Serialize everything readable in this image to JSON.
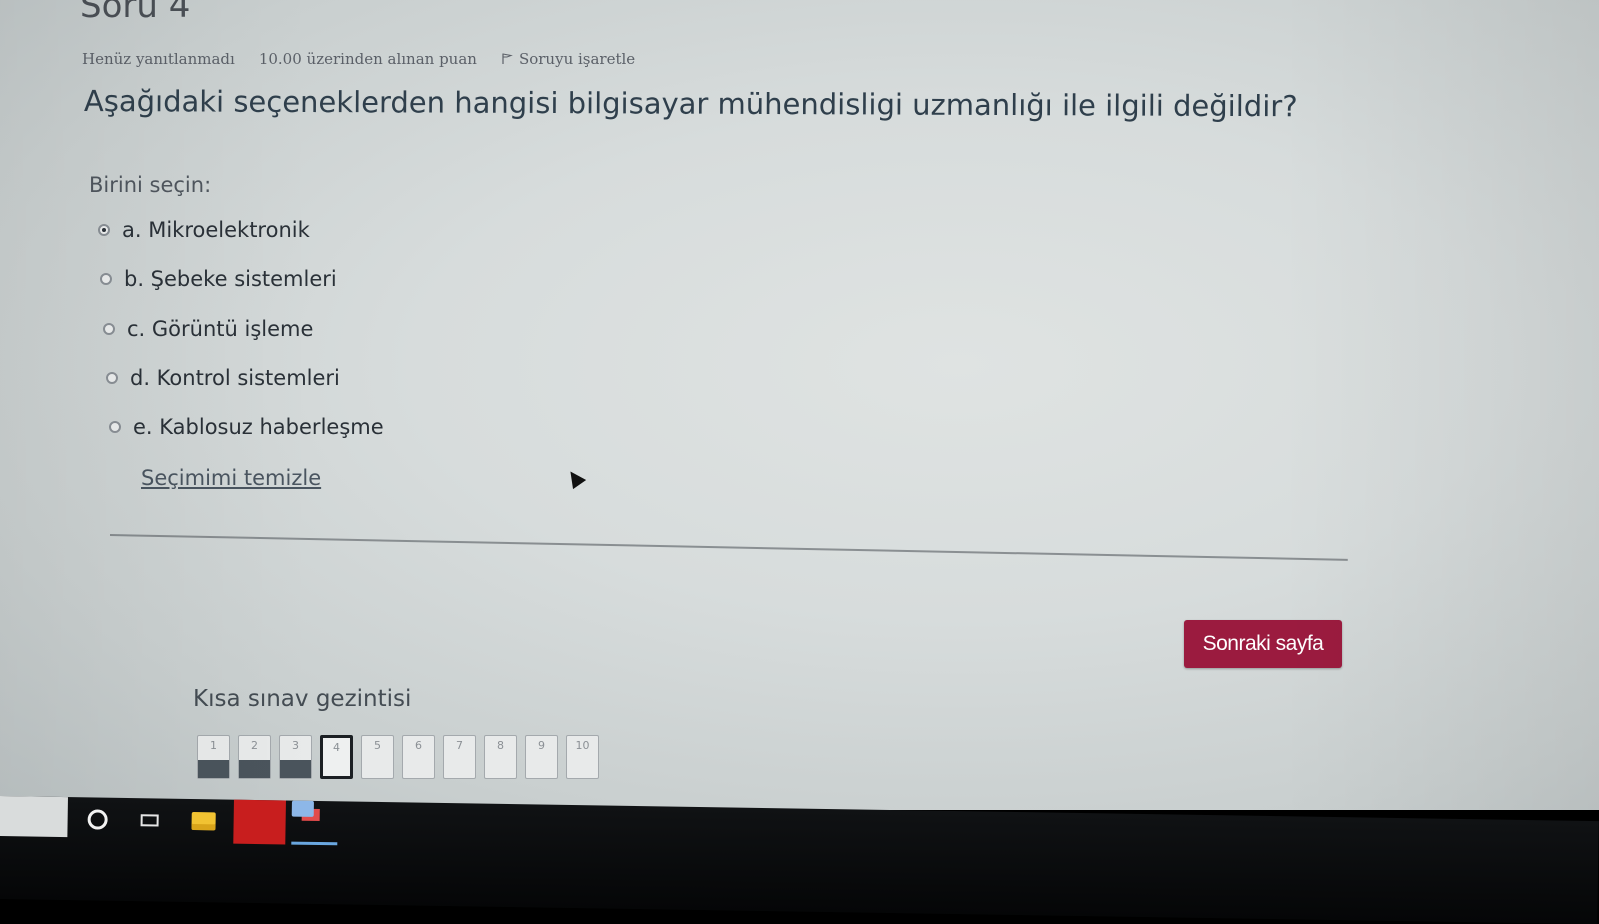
{
  "question": {
    "title": "Soru 4",
    "status": "Henüz yanıtlanmadı",
    "points": "10.00 üzerinden alınan puan",
    "flag_label": "Soruyu işaretle",
    "text": "Aşağıdaki seçeneklerden hangisi bilgisayar mühendisligi uzmanlığı ile ilgili değildir?",
    "prompt": "Birini seçin:",
    "answers": [
      {
        "label": "a. Mikroelektronik",
        "selected": true
      },
      {
        "label": "b. Şebeke sistemleri",
        "selected": false
      },
      {
        "label": "c. Görüntü işleme",
        "selected": false
      },
      {
        "label": "d. Kontrol sistemleri",
        "selected": false
      },
      {
        "label": "e. Kablosuz haberleşme",
        "selected": false
      }
    ],
    "clear_label": "Seçimimi temizle"
  },
  "next_button": "Sonraki sayfa",
  "navigation": {
    "title": "Kısa sınav gezintisi",
    "buttons": [
      {
        "label": "1",
        "state": "answered"
      },
      {
        "label": "2",
        "state": "answered"
      },
      {
        "label": "3",
        "state": "answered"
      },
      {
        "label": "4",
        "state": "current"
      },
      {
        "label": "5",
        "state": "empty"
      },
      {
        "label": "6",
        "state": "empty"
      },
      {
        "label": "7",
        "state": "empty"
      },
      {
        "label": "8",
        "state": "empty"
      },
      {
        "label": "9",
        "state": "empty"
      },
      {
        "label": "10",
        "state": "empty"
      }
    ]
  },
  "taskbar": {
    "icons": [
      "search-icon",
      "task-view-icon",
      "file-explorer-icon",
      "red-app-icon",
      "active-app-icon"
    ]
  },
  "colors": {
    "accent": "#9b1b3f",
    "background": "#d9dede",
    "text": "#2f3f4c"
  }
}
